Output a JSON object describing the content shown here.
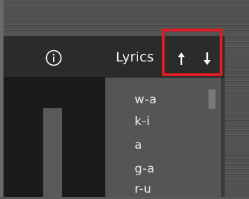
{
  "toolbar": {
    "info_icon": "info-circle-icon",
    "lyrics_label": "Lyrics",
    "move_up_icon": "arrow-up-icon",
    "move_down_icon": "arrow-down-icon"
  },
  "lyrics_list": {
    "syllables": [
      "w-a",
      "k-i",
      "a",
      "g-a",
      "r-u"
    ]
  },
  "colors": {
    "highlight": "#e21c24",
    "toolbar_bg": "#2b2b2b",
    "list_bg": "#555555",
    "text": "#f2f2f2"
  }
}
